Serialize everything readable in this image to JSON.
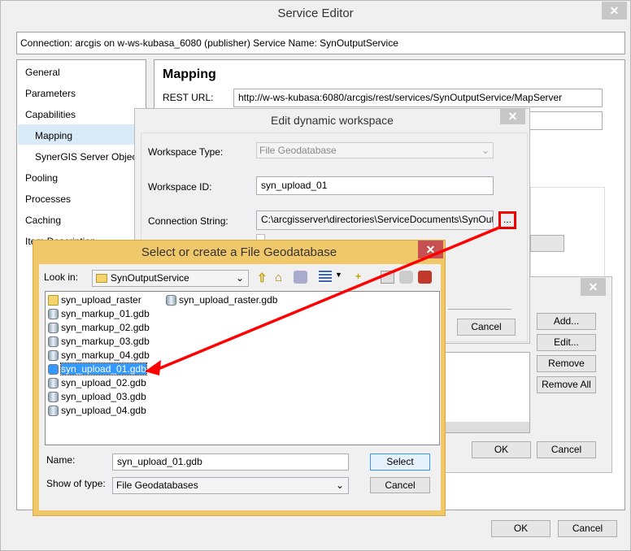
{
  "service_editor": {
    "title": "Service Editor",
    "connection": "Connection: arcgis on w-ws-kubasa_6080 (publisher)   Service Name: SynOutputService",
    "nav": [
      "General",
      "Parameters",
      "Capabilities",
      "Mapping",
      "SynerGIS Server Object Extension",
      "Pooling",
      "Processes",
      "Caching",
      "Item Description"
    ],
    "section_title": "Mapping",
    "rest_url_label": "REST URL:",
    "rest_url": "http://w-ws-kubasa:6080/arcgis/rest/services/SynOutputService/MapServer",
    "ok": "OK",
    "cancel": "Cancel"
  },
  "workspaces_dialog": {
    "add": "Add...",
    "edit": "Edit...",
    "remove": "Remove",
    "remove_all": "Remove All",
    "ok": "OK",
    "cancel": "Cancel"
  },
  "edit_workspace": {
    "title": "Edit dynamic workspace",
    "type_label": "Workspace Type:",
    "type_value": "File Geodatabase",
    "id_label": "Workspace ID:",
    "id_value": "syn_upload_01",
    "conn_label": "Connection String:",
    "conn_value": "C:\\arcgisserver\\directories\\ServiceDocuments\\SynOutputService",
    "browse": "...",
    "cancel": "Cancel"
  },
  "file_dialog": {
    "title": "Select or create a File Geodatabase",
    "look_in_label": "Look in:",
    "look_in": "SynOutputService",
    "items": [
      {
        "name": "syn_upload_raster",
        "type": "folder"
      },
      {
        "name": "syn_markup_01.gdb",
        "type": "gdb"
      },
      {
        "name": "syn_markup_02.gdb",
        "type": "gdb"
      },
      {
        "name": "syn_markup_03.gdb",
        "type": "gdb"
      },
      {
        "name": "syn_markup_04.gdb",
        "type": "gdb"
      },
      {
        "name": "syn_upload_01.gdb",
        "type": "gdb",
        "selected": true
      },
      {
        "name": "syn_upload_02.gdb",
        "type": "gdb"
      },
      {
        "name": "syn_upload_03.gdb",
        "type": "gdb"
      },
      {
        "name": "syn_upload_04.gdb",
        "type": "gdb"
      },
      {
        "name": "syn_upload_raster.gdb",
        "type": "gdb"
      }
    ],
    "name_label": "Name:",
    "name_value": "syn_upload_01.gdb",
    "type_label": "Show of type:",
    "type_value": "File Geodatabases",
    "select": "Select",
    "cancel": "Cancel"
  },
  "colors": {
    "accent": "#3399ff",
    "dialog_frame": "#f0c86a",
    "close_red": "#c75050",
    "annotation": "#ff0000"
  }
}
